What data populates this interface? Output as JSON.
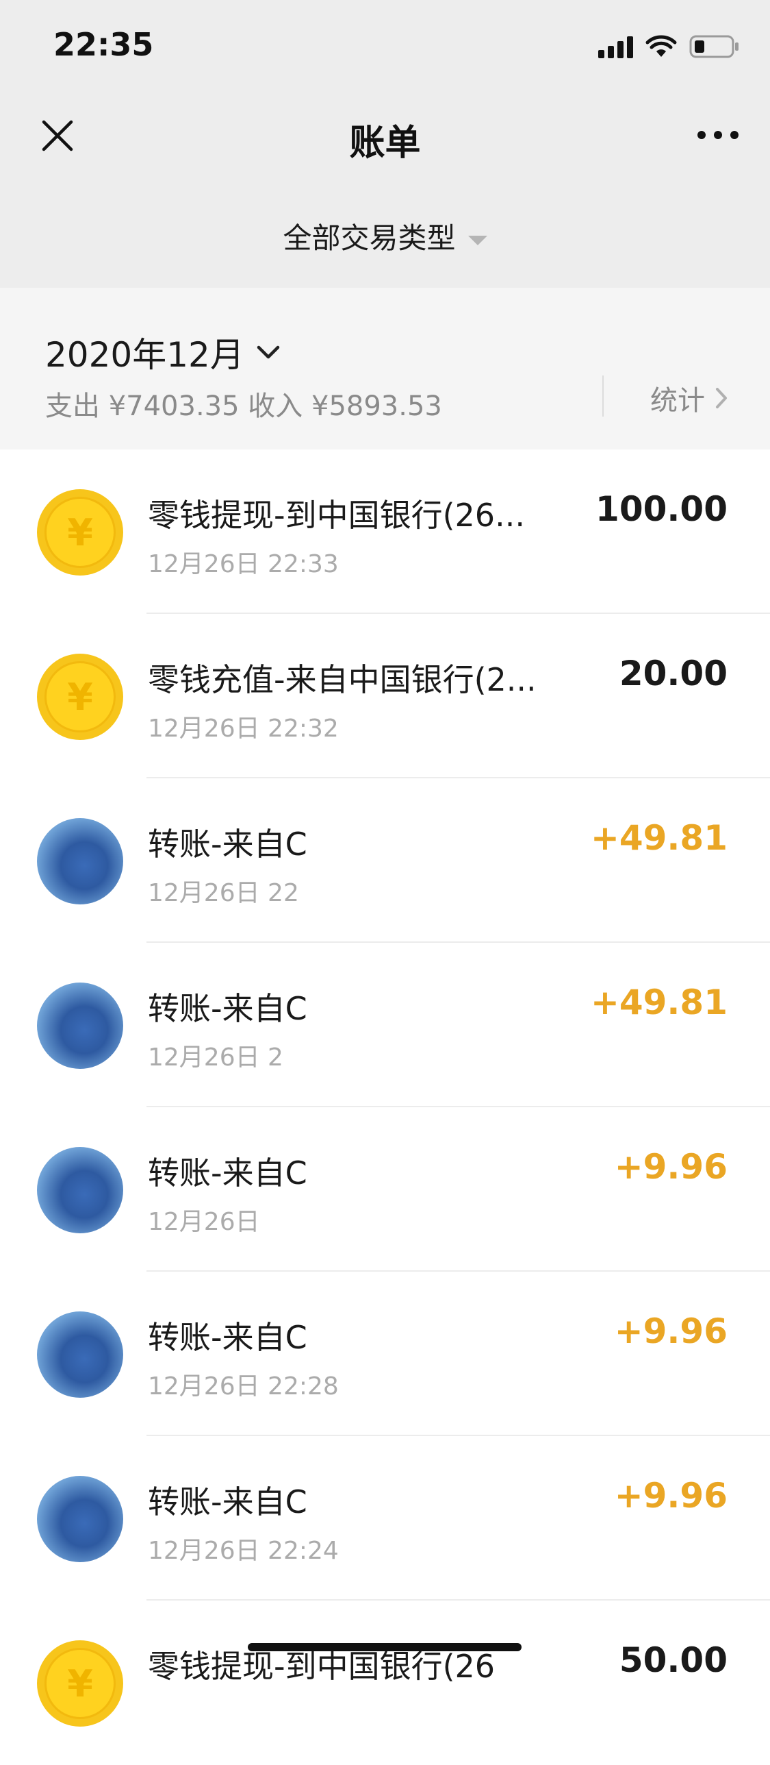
{
  "status_bar": {
    "time": "22:35"
  },
  "nav": {
    "title": "账单",
    "close_icon": "close-icon",
    "more_icon": "more-icon"
  },
  "filter": {
    "label": "全部交易类型"
  },
  "month": {
    "label": "2020年12月",
    "summary": "支出 ¥7403.35 收入 ¥5893.53",
    "stats_label": "统计"
  },
  "colors": {
    "income": "#eaa624",
    "coin": "#f7c51b",
    "background": "#ededed"
  },
  "transactions": [
    {
      "title": "零钱提现-到中国银行(26...",
      "time": "12月26日 22:33",
      "amount": "100.00",
      "icon": "coin-icon"
    },
    {
      "title": "零钱充值-来自中国银行(2...",
      "time": "12月26日 22:32",
      "amount": "20.00",
      "icon": "coin-icon"
    },
    {
      "title": "转账-来自C",
      "time": "12月26日 22",
      "amount": "+49.81",
      "icon": "avatar-photo"
    },
    {
      "title": "转账-来自C",
      "time": "12月26日 2",
      "amount": "+49.81",
      "icon": "avatar-photo"
    },
    {
      "title": "转账-来自C",
      "time": "12月26日",
      "amount": "+9.96",
      "icon": "avatar-photo"
    },
    {
      "title": "转账-来自C",
      "time": "12月26日 22:28",
      "amount": "+9.96",
      "icon": "avatar-photo"
    },
    {
      "title": "转账-来自C",
      "time": "12月26日 22:24",
      "amount": "+9.96",
      "icon": "avatar-photo"
    },
    {
      "title": "零钱提现-到中国银行(26",
      "time": "",
      "amount": "50.00",
      "icon": "coin-icon"
    }
  ]
}
